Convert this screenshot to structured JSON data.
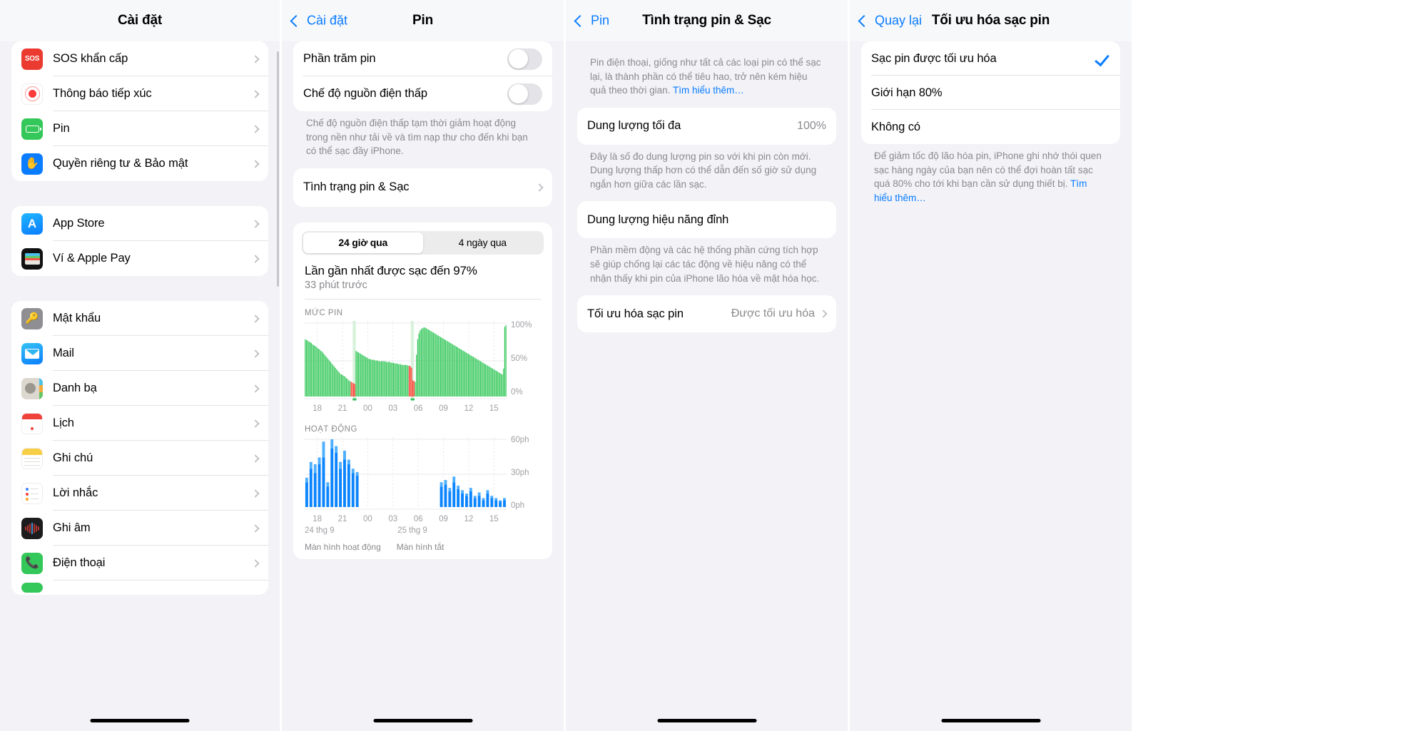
{
  "screen1": {
    "title": "Cài đặt",
    "groups": [
      {
        "items": [
          {
            "label": "SOS khẩn cấp",
            "icon": "sos-icon"
          },
          {
            "label": "Thông báo tiếp xúc",
            "icon": "exposure-notification-icon"
          },
          {
            "label": "Pin",
            "icon": "battery-icon"
          },
          {
            "label": "Quyền riêng tư & Bảo mật",
            "icon": "privacy-hand-icon"
          }
        ]
      },
      {
        "items": [
          {
            "label": "App Store",
            "icon": "app-store-icon"
          },
          {
            "label": "Ví & Apple Pay",
            "icon": "wallet-icon"
          }
        ]
      },
      {
        "items": [
          {
            "label": "Mật khẩu",
            "icon": "passwords-key-icon"
          },
          {
            "label": "Mail",
            "icon": "mail-icon"
          },
          {
            "label": "Danh bạ",
            "icon": "contacts-icon"
          },
          {
            "label": "Lịch",
            "icon": "calendar-icon"
          },
          {
            "label": "Ghi chú",
            "icon": "notes-icon"
          },
          {
            "label": "Lời nhắc",
            "icon": "reminders-icon"
          },
          {
            "label": "Ghi âm",
            "icon": "voice-memos-icon"
          },
          {
            "label": "Điện thoại",
            "icon": "phone-icon"
          }
        ]
      }
    ]
  },
  "screen2": {
    "back_label": "Cài đặt",
    "title": "Pin",
    "toggles": [
      {
        "label": "Phần trăm pin",
        "on": false
      },
      {
        "label": "Chế độ nguồn điện thấp",
        "on": false
      }
    ],
    "low_power_footnote": "Chế độ nguồn điện thấp tạm thời giảm hoạt động trong nền như tải về và tìm nạp thư cho đến khi bạn có thể sạc đầy iPhone.",
    "battery_health_row": "Tình trạng pin & Sạc",
    "segments": [
      {
        "label": "24 giờ qua",
        "active": true
      },
      {
        "label": "4 ngày qua",
        "active": false
      }
    ],
    "last_charge_title": "Lần gần nhất được sạc đến 97%",
    "last_charge_sub": "33 phút trước",
    "battery_level_label": "MỨC PIN",
    "activity_label": "HOẠT ĐỘNG",
    "day_labels": [
      "24 thg 9",
      "25 thg 9"
    ],
    "bottom_legend": [
      "Màn hình hoạt động",
      "Màn hình tắt"
    ]
  },
  "screen3": {
    "back_label": "Pin",
    "title": "Tình trạng pin & Sạc",
    "intro": "Pin điện thoại, giống như tất cả các loại pin có thể sạc lại, là thành phần có thể tiêu hao, trở nên kém hiệu quả theo thời gian.",
    "intro_link": "Tìm hiểu thêm…",
    "max_capacity_label": "Dung lượng tối đa",
    "max_capacity_value": "100%",
    "max_capacity_footnote": "Đây là số đo dung lượng pin so với khi pin còn mới. Dung lượng thấp hơn có thể dẫn đến số giờ sử dụng ngắn hơn giữa các lần sạc.",
    "peak_performance_label": "Dung lượng hiệu năng đỉnh",
    "peak_performance_footnote": "Phần mềm động và các hệ thống phần cứng tích hợp sẽ giúp chống lại các tác động về hiệu năng có thể nhận thấy khi pin của iPhone lão hóa về mặt hóa học.",
    "optimized_label": "Tối ưu hóa sạc pin",
    "optimized_value": "Được tối ưu hóa"
  },
  "screen4": {
    "back_label": "Quay lại",
    "title": "Tối ưu hóa sạc pin",
    "options": [
      {
        "label": "Sạc pin được tối ưu hóa",
        "selected": true
      },
      {
        "label": "Giới hạn 80%",
        "selected": false
      },
      {
        "label": "Không có",
        "selected": false
      }
    ],
    "footnote": "Để giảm tốc độ lão hóa pin, iPhone ghi nhớ thói quen sạc hàng ngày của bạn nên có thể đợi hoàn tất sạc quá 80% cho tới khi bạn cần sử dụng thiết bị.",
    "footnote_link": "Tìm hiểu thêm…"
  },
  "colors": {
    "accent": "#0a7cff",
    "green": "#34c759",
    "red": "#ff3b30",
    "blue_bar": "#0a84ff",
    "light_blue_bar": "#4fb0ff",
    "bg": "#f2f2f7"
  },
  "chart_data": [
    {
      "type": "bar",
      "title": "MỨC PIN",
      "ylabel": "",
      "xlabel": "",
      "ylim": [
        0,
        100
      ],
      "ytick_labels": [
        "100%",
        "50%",
        "0%"
      ],
      "ytick_values": [
        100,
        50,
        0
      ],
      "xtick_labels": [
        "18",
        "21",
        "00",
        "03",
        "06",
        "09",
        "12",
        "15"
      ],
      "grid": true,
      "series": [
        {
          "name": "Mức pin",
          "colors_by_index": "green except charging-red segments",
          "values": [
            78,
            77,
            76,
            75,
            74,
            73,
            71,
            70,
            69,
            68,
            66,
            65,
            64,
            62,
            61,
            59,
            57,
            55,
            53,
            51,
            49,
            47,
            45,
            43,
            41,
            39,
            37,
            35,
            33,
            31,
            30,
            29,
            28,
            27,
            25,
            24,
            22,
            21,
            20,
            19,
            18,
            17,
            62,
            61,
            60,
            59,
            58,
            57,
            56,
            55,
            54,
            53,
            52,
            51,
            51,
            50,
            50,
            50,
            49,
            49,
            49,
            48,
            48,
            48,
            48,
            48,
            48,
            47,
            47,
            47,
            47,
            46,
            46,
            46,
            45,
            45,
            45,
            44,
            44,
            44,
            43,
            43,
            43,
            43,
            43,
            42,
            42,
            41,
            39,
            22,
            21,
            20,
            57,
            78,
            86,
            90,
            92,
            93,
            94,
            94,
            93,
            92,
            91,
            90,
            89,
            88,
            87,
            86,
            85,
            84,
            83,
            82,
            81,
            80,
            79,
            78,
            77,
            76,
            75,
            74,
            73,
            72,
            71,
            70,
            69,
            68,
            67,
            66,
            65,
            64,
            63,
            62,
            61,
            60,
            59,
            58,
            57,
            56,
            55,
            54,
            53,
            52,
            51,
            50,
            49,
            48,
            47,
            46,
            45,
            44,
            43,
            42,
            41,
            40,
            39,
            38,
            37,
            36,
            35,
            34,
            33,
            32,
            31,
            30,
            38,
            95,
            97
          ]
        }
      ],
      "charging_marker_positions": [
        41,
        89
      ],
      "note": "Green bars = battery level, red bars = low battery, light green vertical bands = charging periods"
    },
    {
      "type": "bar",
      "title": "HOẠT ĐỘNG",
      "ylabel": "",
      "xlabel": "",
      "ylim": [
        0,
        60
      ],
      "ytick_labels": [
        "60ph",
        "30ph",
        "0ph"
      ],
      "ytick_values": [
        60,
        30,
        0
      ],
      "xtick_labels": [
        "18",
        "21",
        "00",
        "03",
        "06",
        "09",
        "12",
        "15"
      ],
      "grid": true,
      "series": [
        {
          "name": "Màn hình hoạt động",
          "color": "#0a84ff",
          "values": [
            22,
            34,
            30,
            38,
            44,
            18,
            52,
            48,
            34,
            42,
            38,
            30,
            28,
            0,
            0,
            0,
            0,
            0,
            0,
            0,
            0,
            0,
            0,
            0,
            0,
            0,
            0,
            0,
            0,
            0,
            0,
            0,
            18,
            20,
            14,
            22,
            16,
            12,
            10,
            14,
            8,
            10,
            6,
            12,
            8,
            6,
            5,
            6
          ]
        },
        {
          "name": "Màn hình tắt",
          "color": "#4fb0ff",
          "values": [
            4,
            6,
            8,
            6,
            14,
            4,
            8,
            6,
            6,
            8,
            4,
            4,
            3,
            0,
            0,
            0,
            0,
            0,
            0,
            0,
            0,
            0,
            0,
            0,
            0,
            0,
            0,
            0,
            0,
            0,
            0,
            0,
            4,
            4,
            3,
            5,
            3,
            3,
            2,
            3,
            2,
            3,
            2,
            3,
            2,
            2,
            1,
            2
          ]
        }
      ]
    }
  ]
}
